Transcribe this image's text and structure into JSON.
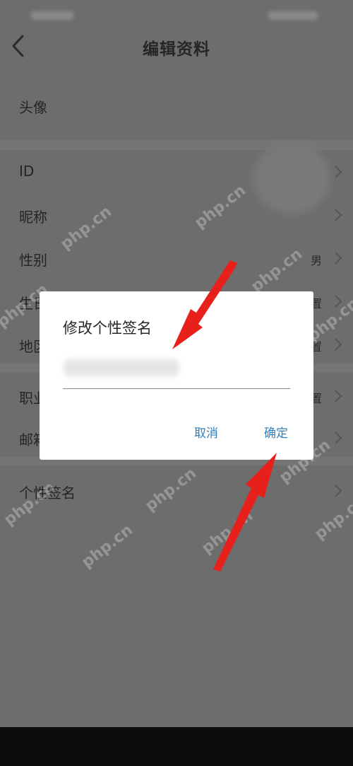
{
  "header": {
    "title": "编辑资料"
  },
  "profile_rows": [
    {
      "label": "头像",
      "value": ""
    },
    {
      "label": "ID",
      "value": ""
    },
    {
      "label": "昵称",
      "value": ""
    },
    {
      "label": "性别",
      "value": "男"
    },
    {
      "label": "生日",
      "value": "置"
    },
    {
      "label": "地区",
      "value": "置"
    },
    {
      "label": "职业",
      "value": "置"
    },
    {
      "label": "邮箱",
      "value": ""
    },
    {
      "label": "个性签名",
      "value": ""
    }
  ],
  "dialog": {
    "title": "修改个性签名",
    "input_value": "",
    "cancel_label": "取消",
    "confirm_label": "确定"
  },
  "watermark": "php.cn",
  "colors": {
    "overlay": "#6d6d6d",
    "dialog_bg": "#ffffff",
    "action_blue": "#2f7fba",
    "arrow_red": "#e8201c"
  },
  "icons": {
    "back": "chevron-left-icon",
    "row_arrow": "chevron-right-icon"
  }
}
